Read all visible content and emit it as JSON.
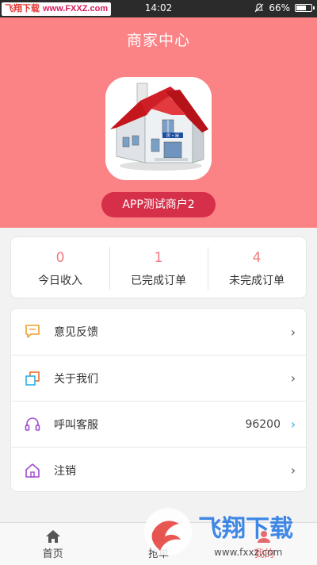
{
  "status_bar": {
    "watermark_cn": "飞翔下载",
    "watermark_url": "www.FXXZ.com",
    "time": "14:02",
    "battery": "66%",
    "battery_level": 0.66
  },
  "header": {
    "title": "商家中心",
    "merchant_name": "APP测试商户2"
  },
  "stats": [
    {
      "value": "0",
      "label": "今日收入"
    },
    {
      "value": "1",
      "label": "已完成订单"
    },
    {
      "value": "4",
      "label": "未完成订单"
    }
  ],
  "menu": [
    {
      "label": "意见反馈",
      "value": "",
      "icon": "feedback-icon"
    },
    {
      "label": "关于我们",
      "value": "",
      "icon": "about-icon"
    },
    {
      "label": "呼叫客服",
      "value": "96200",
      "icon": "headset-icon"
    },
    {
      "label": "注销",
      "value": "",
      "icon": "logout-home-icon"
    }
  ],
  "tabbar": [
    {
      "label": "首页",
      "icon": "home-icon"
    },
    {
      "label": "抢单",
      "icon": "grab-order-icon"
    },
    {
      "label": "我的",
      "icon": "mine-icon"
    }
  ],
  "footer_watermark": {
    "brand": "飞翔下载",
    "url": "www.fxxz.com"
  },
  "colors": {
    "header_bg": "#fb8285",
    "pill_bg": "#d62f4a",
    "stat_number": "#f07a80",
    "accent_blue": "#2ab0e8"
  }
}
